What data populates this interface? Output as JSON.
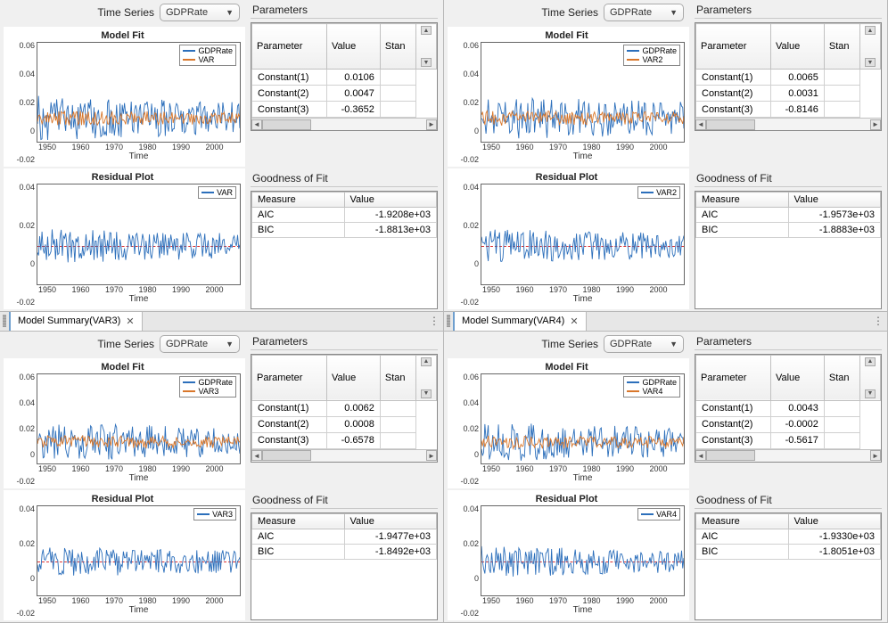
{
  "common": {
    "ts_label": "Time Series",
    "ts_value": "GDPRate",
    "params_title": "Parameters",
    "gof_title": "Goodness of Fit",
    "param_cols": [
      "Parameter",
      "Value",
      "Stan"
    ],
    "gof_cols": [
      "Measure",
      "Value"
    ],
    "modelfit_title": "Model Fit",
    "residual_title": "Residual Plot",
    "xlabel": "Time",
    "xticks": [
      "1950",
      "1960",
      "1970",
      "1980",
      "1990",
      "2000",
      ""
    ],
    "fit_yticks": [
      "0.06",
      "0.04",
      "0.02",
      "0",
      "-0.02"
    ],
    "resid_yticks": [
      "0.04",
      "0.02",
      "0",
      "-0.02"
    ]
  },
  "panels": [
    {
      "tab": null,
      "legend_fit": [
        "GDPRate",
        "VAR"
      ],
      "legend_res": [
        "VAR"
      ],
      "params": [
        {
          "name": "Constant(1)",
          "value": "0.0106"
        },
        {
          "name": "Constant(2)",
          "value": "0.0047"
        },
        {
          "name": "Constant(3)",
          "value": "-0.3652"
        }
      ],
      "gof": [
        {
          "name": "AIC",
          "value": "-1.9208e+03"
        },
        {
          "name": "BIC",
          "value": "-1.8813e+03"
        }
      ]
    },
    {
      "tab": null,
      "legend_fit": [
        "GDPRate",
        "VAR2"
      ],
      "legend_res": [
        "VAR2"
      ],
      "params": [
        {
          "name": "Constant(1)",
          "value": "0.0065"
        },
        {
          "name": "Constant(2)",
          "value": "0.0031"
        },
        {
          "name": "Constant(3)",
          "value": "-0.8146"
        }
      ],
      "gof": [
        {
          "name": "AIC",
          "value": "-1.9573e+03"
        },
        {
          "name": "BIC",
          "value": "-1.8883e+03"
        }
      ]
    },
    {
      "tab": "Model Summary(VAR3)",
      "legend_fit": [
        "GDPRate",
        "VAR3"
      ],
      "legend_res": [
        "VAR3"
      ],
      "params": [
        {
          "name": "Constant(1)",
          "value": "0.0062"
        },
        {
          "name": "Constant(2)",
          "value": "0.0008"
        },
        {
          "name": "Constant(3)",
          "value": "-0.6578"
        }
      ],
      "gof": [
        {
          "name": "AIC",
          "value": "-1.9477e+03"
        },
        {
          "name": "BIC",
          "value": "-1.8492e+03"
        }
      ]
    },
    {
      "tab": "Model Summary(VAR4)",
      "legend_fit": [
        "GDPRate",
        "VAR4"
      ],
      "legend_res": [
        "VAR4"
      ],
      "params": [
        {
          "name": "Constant(1)",
          "value": "0.0043"
        },
        {
          "name": "Constant(2)",
          "value": "-0.0002"
        },
        {
          "name": "Constant(3)",
          "value": "-0.5617"
        }
      ],
      "gof": [
        {
          "name": "AIC",
          "value": "-1.9330e+03"
        },
        {
          "name": "BIC",
          "value": "-1.8051e+03"
        }
      ]
    }
  ],
  "chart_data": {
    "type": "line",
    "note": "Displayed series are GDPRate (blue) and VAR* model fit (orange) over 1947–2009. Residuals oscillate around zero (dashed red). Values are qualitative; exact y-values are not labeled in the source.",
    "fit_ylim": [
      -0.03,
      0.07
    ],
    "resid_ylim": [
      -0.03,
      0.05
    ],
    "x_range": [
      1947,
      2009
    ]
  }
}
